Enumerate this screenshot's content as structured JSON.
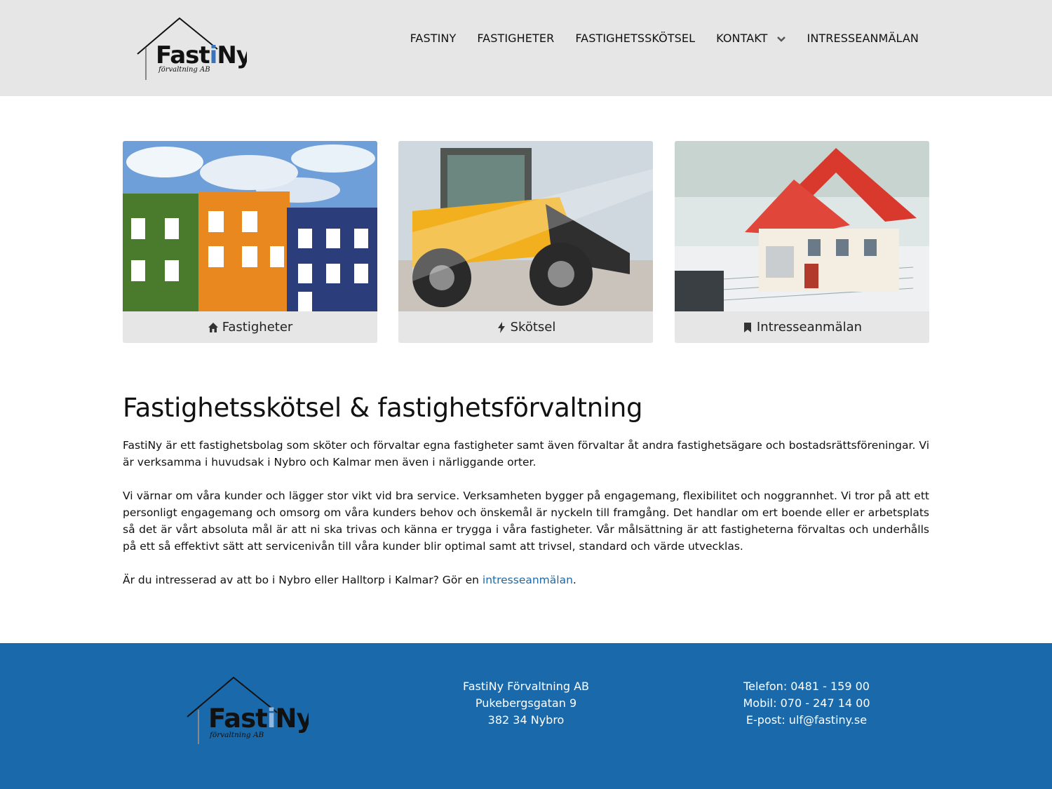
{
  "header": {
    "logo": {
      "name": "FastiNy",
      "tagline": "förvaltning AB"
    },
    "nav": [
      {
        "label": "FASTINY"
      },
      {
        "label": "FASTIGHETER"
      },
      {
        "label": "FASTIGHETSSKÖTSEL"
      },
      {
        "label": "KONTAKT",
        "has_dropdown": true,
        "icon": "chevron-down-icon"
      },
      {
        "label": "INTRESSEANMÄLAN"
      }
    ]
  },
  "cards": [
    {
      "label": "Fastigheter",
      "icon": "home-icon"
    },
    {
      "label": "Skötsel",
      "icon": "lightning-icon"
    },
    {
      "label": "Intresseanmälan",
      "icon": "bookmark-icon"
    }
  ],
  "content": {
    "title": "Fastighetsskötsel & fastighetsförvaltning",
    "paragraphs": [
      "FastiNy är ett fastighetsbolag som sköter och förvaltar egna fastigheter samt även förvaltar åt andra fastighetsägare och bostadsrättsföreningar. Vi är verksamma i huvudsak i Nybro och Kalmar men även i närliggande orter.",
      "Vi värnar om våra kunder och lägger stor vikt vid bra service. Verksamheten bygger på engagemang, flexibilitet och noggrannhet. Vi tror på att ett personligt engagemang och omsorg om våra kunders behov och önskemål är nyckeln till framgång. Det handlar om ert boende eller er arbetsplats så det är vårt absoluta mål är att ni ska trivas och känna er trygga i våra fastigheter. Vår målsättning är att fastigheterna förvaltas och underhålls på ett så effektivt sätt att servicenivån till våra kunder blir optimal samt att trivsel, standard och värde utvecklas."
    ],
    "cta_prefix": "Är du intresserad av att bo i Nybro eller Halltorp i Kalmar? Gör en ",
    "cta_link": "intresseanmälan",
    "cta_suffix": "."
  },
  "footer": {
    "address": [
      "FastiNy Förvaltning AB",
      "Pukebergsgatan 9",
      "382 34 Nybro"
    ],
    "contact": [
      "Telefon: 0481 - 159 00",
      "Mobil: 070 - 247 14 00",
      "E-post: ulf@fastiny.se"
    ]
  },
  "colors": {
    "header_bg": "#e6e6e6",
    "footer_bg": "#1a6aab",
    "link": "#1e6aa8"
  }
}
